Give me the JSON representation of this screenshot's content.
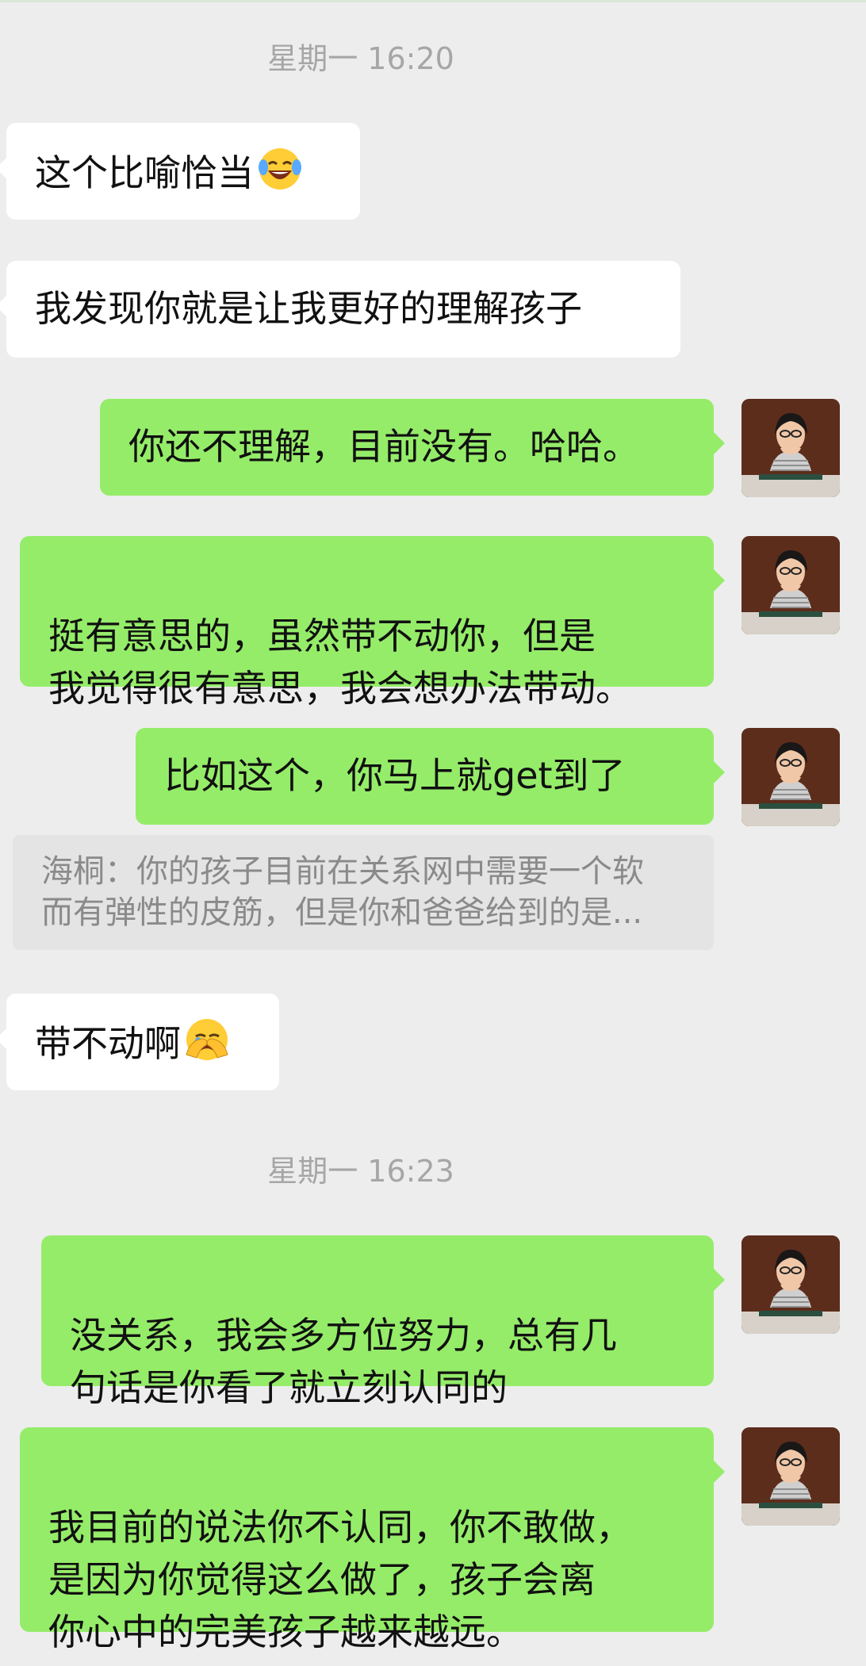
{
  "timestamps": [
    "星期一 16:20",
    "星期一 16:23"
  ],
  "messages": [
    {
      "direction": "incoming",
      "text": "这个比喻恰当",
      "emoji": "tears-of-joy-emoji"
    },
    {
      "direction": "incoming",
      "text": "我发现你就是让我更好的理解孩子"
    },
    {
      "direction": "outgoing",
      "text": "你还不理解，目前没有。哈哈。"
    },
    {
      "direction": "outgoing",
      "text": "挺有意思的，虽然带不动你，但是\n我觉得很有意思，我会想办法带动。"
    },
    {
      "direction": "outgoing",
      "text": "比如这个，你马上就get到了"
    },
    {
      "direction": "incoming",
      "text": "带不动啊",
      "emoji": "face-palm-crying-emoji"
    },
    {
      "direction": "outgoing",
      "text": "没关系，我会多方位努力，总有几\n句话是你看了就立刻认同的"
    },
    {
      "direction": "outgoing",
      "text": "我目前的说法你不认同，你不敢做，\n是因为你觉得这么做了，孩子会离\n你心中的完美孩子越来越远。"
    }
  ],
  "quote": {
    "text": "海桐：你的孩子目前在关系网中需要一个软\n而有弹性的皮筋，但是你和爸爸给到的是..."
  },
  "colors": {
    "background": "#ededed",
    "incoming_bubble": "#ffffff",
    "outgoing_bubble": "#95ec69",
    "timestamp_text": "#a6a6a6",
    "quote_background": "#e4e4e4",
    "quote_text": "#8a8a8a"
  }
}
